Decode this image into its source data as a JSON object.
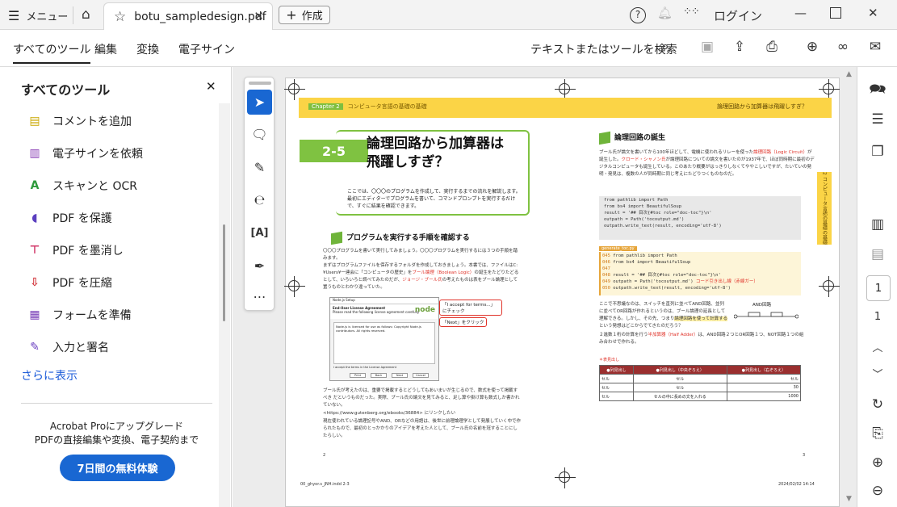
{
  "titlebar": {
    "menu_label": "メニュー",
    "tab_title": "botu_sampledesign.pdf",
    "new_label": "作成",
    "login_label": "ログイン"
  },
  "menubar": {
    "tabs": [
      "すべてのツール",
      "編集",
      "変換",
      "電子サイン"
    ],
    "search_label": "テキストまたはツールを検索"
  },
  "sidebar": {
    "title": "すべてのツール",
    "items": [
      {
        "label": "コメントを追加",
        "color": "#c9a700",
        "icon": "comment-icon"
      },
      {
        "label": "電子サインを依頼",
        "color": "#8a3fb5",
        "icon": "request-sign-icon"
      },
      {
        "label": "スキャンと OCR",
        "color": "#2e9a3c",
        "icon": "scan-ocr-icon"
      },
      {
        "label": "PDF を保護",
        "color": "#5b3fc0",
        "icon": "protect-icon"
      },
      {
        "label": "PDF を墨消し",
        "color": "#d23a6a",
        "icon": "redact-icon"
      },
      {
        "label": "PDF を圧縮",
        "color": "#d2343a",
        "icon": "compress-icon"
      },
      {
        "label": "フォームを準備",
        "color": "#7a3fb8",
        "icon": "form-icon"
      },
      {
        "label": "入力と署名",
        "color": "#6a3fc0",
        "icon": "fill-sign-icon"
      }
    ],
    "more_label": "さらに表示",
    "upgrade_line1": "Acrobat Proにアップグレード",
    "upgrade_line2": "PDFの直接編集や変換、電子契約まで",
    "trial_label": "7日間の無料体験"
  },
  "rightbar": {
    "page_current": "1",
    "page_total": "1"
  },
  "document": {
    "band_left_chip": "Chapter 2",
    "band_left": "コンピュータ言語の基礎の基礎",
    "band_right": "論理回路から加算器は飛躍しすぎ？",
    "chapter": "2-5",
    "heading_line1": "論理回路から加算器は",
    "heading_line2": "飛躍しすぎ？",
    "intro": "ここでは、〇〇〇のプログラムを作成して、実行するまでの流れを解説します。最初にエディターでプログラムを書いて、コマンドプロンプトを実行するだけで、すぐに結果を確認できます。",
    "sec1": "プログラムを実行する手順を確認する",
    "para1": "〇〇〇プログラムを書いて実行してみましょう。〇〇〇プログラムを実行するには３つの手順を踏みます。",
    "para2_a": "まずはプログラムファイルを保存するフォルダを作成しておきましょう。本書では、ファイルはC:¥Users¥一連会に「コンピュータの歴史」を",
    "para2_hl": "ブール論理（Boolean Logic）",
    "para2_b": "の誕生をたどりたどるとして、いろいろと調べてみたのだが、",
    "para2_hl2": "ジョージ・ブール氏",
    "para2_c": "の考えたものは表をブール論理として置うものとわかり違っていた。",
    "sshot_title": "Node.js Setup",
    "sshot_sub": "End-User License Agreement",
    "sshot_sub2": "Please read the following license agreement carefully",
    "sshot_body": "Node.js is licensed for use as follows: Copyright Node.js contributors. All rights reserved.",
    "sshot_check": "I accept the terms in the License Agreement",
    "sshot_btns": [
      "Print",
      "Back",
      "Next",
      "Cancel"
    ],
    "callout1": "「I accept for terms...」にチェック",
    "callout2": "「Next」をクリック",
    "para3": "ブール氏が考えたのは、重要で掲載するとどうしてもあいまいが生じるので、数式を使って掲載すべき だというものだった。実際、ブール氏の論文を見てみると、足し算や掛け算も数式しか書かれていない。",
    "para3_url": "<https://www.gutenberg.org/ebooks/36884> にリンクしたい",
    "para4": "現在使われている論理記号やAND、ORなどの用語は、後世に前理論理学として発展していく中で作られたもので、最初のとっかかりのアイデアを考えた人として、ブール氏の名前を冠することにしたらしい。",
    "page_left": "2",
    "page_right": "3",
    "sec2": "論理回路の誕生",
    "para5_a": "ブール氏が論文を書いてから100年ほどして、電機に使われるリレーを使った",
    "para5_hl": "論理回路（Logic Circuit）",
    "para5_b": "が誕生した。",
    "para5_hl2": "クロード・シャノン氏",
    "para5_c": "が論理回路についての論文を書いたのが1937年で、ほぼ同時期に最初のデジタルコンピュータも誕生している。このあたり概要がはっきりしなくてややこしいですが、たいていの発明・発見は、複数の人が同時期に同じ考えにたどりつくものなのだ。",
    "code1": [
      "from pathlib import Path",
      "from bs4 import BeautifulSoup",
      "",
      "result = '## 目次{#toc role=\"doc-toc\"}\\n'",
      "outpath = Path('tocoutput.md')",
      "outpath.write_text(result, encoding='utf-8')"
    ],
    "code2_label": "generate_toc.py",
    "code2": [
      {
        "n": "045",
        "t": "from pathlib import Path"
      },
      {
        "n": "046",
        "t": "from bs4 import BeautifulSoup"
      },
      {
        "n": "047",
        "t": ""
      },
      {
        "n": "048",
        "t": "result = '## 目次{#toc role=\"doc-toc\"}\\n'"
      },
      {
        "n": "049",
        "t": "outpath = Path('tocoutput.md')"
      },
      {
        "n": "050",
        "t": "outpath.write_text(result, encoding='utf-8')"
      }
    ],
    "code2_note": "コード引き出し線（赤線ガー）",
    "para6_a": "ここで不思議なのは、スイッチを直列に並べてAND回路、並列に並べてOR回路が作れるというのは、ブール論理の延長として理解できる。しかし、その先、つまり",
    "para6_hl": "論理回路を使って計算する",
    "para6_b": "という発想はどこからでてきたのだろう？",
    "para7_a": "２進数１桁の計算を行う",
    "para7_hl": "半加算器（Half Adder）",
    "para7_b": "は、AND回路２つとOR回路１つ、NOT回路１つの組み合わせで作れる。",
    "and_label": "AND回路",
    "table_caption": "＊表見出し",
    "table_head": [
      "●列見出し",
      "●列見出し（中央ぞろえ）",
      "●列見出し（右ぞろえ）"
    ],
    "table_rows": [
      [
        "セル",
        "セル",
        "セル"
      ],
      [
        "セル",
        "セル",
        "30"
      ],
      [
        "セル",
        "セルの中に長めの文を入れる",
        "1000"
      ]
    ],
    "vband": "コンピュータ言語の基礎の基礎",
    "vband_no": "2",
    "foot_left": "00_ghyor.s_JNH.indd 2-3",
    "foot_right": "2024/02/02 14:14"
  },
  "colors": {
    "accent": "#1967d2",
    "band": "#fbd446",
    "green": "#7fc241",
    "red": "#e0332a"
  }
}
